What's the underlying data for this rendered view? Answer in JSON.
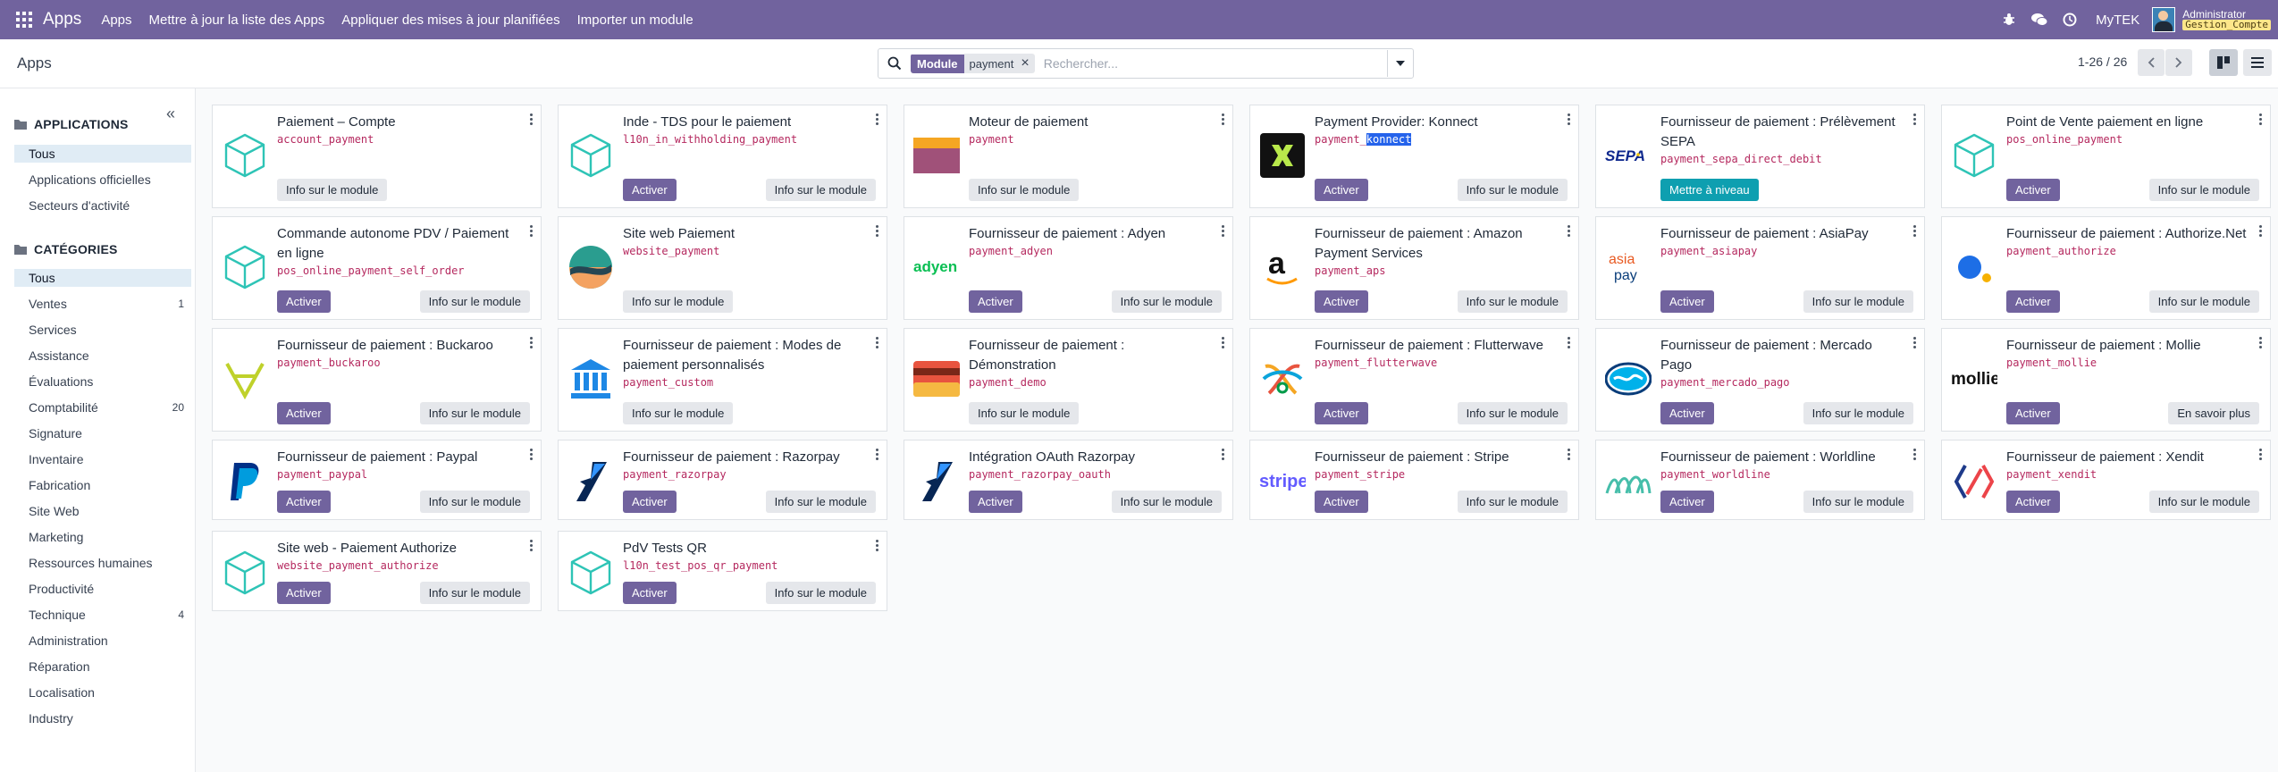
{
  "navbar": {
    "brand": "Apps",
    "menu": [
      "Apps",
      "Mettre à jour la liste des Apps",
      "Appliquer des mises à jour planifiées",
      "Importer un module"
    ],
    "company": "MyTEK",
    "user_name": "Administrator",
    "user_db": "Gestion_Compte",
    "icons": [
      "bug-icon",
      "chat-icon",
      "clock-icon"
    ]
  },
  "control": {
    "breadcrumb": "Apps",
    "search": {
      "facet_label": "Module",
      "facet_value": "payment",
      "placeholder": "Rechercher..."
    },
    "pager": "1-26 / 26"
  },
  "sidebar": {
    "applications_header": "APPLICATIONS",
    "applications": [
      {
        "label": "Tous",
        "active": true
      },
      {
        "label": "Applications officielles"
      },
      {
        "label": "Secteurs d'activité"
      }
    ],
    "categories_header": "CATÉGORIES",
    "categories": [
      {
        "label": "Tous",
        "active": true,
        "count": ""
      },
      {
        "label": "Ventes",
        "count": "1"
      },
      {
        "label": "Services",
        "count": ""
      },
      {
        "label": "Assistance",
        "count": ""
      },
      {
        "label": "Évaluations",
        "count": ""
      },
      {
        "label": "Comptabilité",
        "count": "20"
      },
      {
        "label": "Signature",
        "count": ""
      },
      {
        "label": "Inventaire",
        "count": ""
      },
      {
        "label": "Fabrication",
        "count": ""
      },
      {
        "label": "Site Web",
        "count": ""
      },
      {
        "label": "Marketing",
        "count": ""
      },
      {
        "label": "Ressources humaines",
        "count": ""
      },
      {
        "label": "Productivité",
        "count": ""
      },
      {
        "label": "Technique",
        "count": "4"
      },
      {
        "label": "Administration",
        "count": ""
      },
      {
        "label": "Réparation",
        "count": ""
      },
      {
        "label": "Localisation",
        "count": ""
      },
      {
        "label": "Industry",
        "count": ""
      }
    ]
  },
  "labels": {
    "activate": "Activer",
    "info": "Info sur le module",
    "upgrade": "Mettre à niveau",
    "learn_more": "En savoir plus"
  },
  "modules": [
    {
      "title": "Paiement – Compte",
      "tech": "account_payment",
      "icon": "cube-icon",
      "primary": "",
      "secondary": "info"
    },
    {
      "title": "Inde - TDS pour le paiement",
      "tech": "l10n_in_withholding_payment",
      "icon": "cube-icon",
      "primary": "activate",
      "secondary": "info"
    },
    {
      "title": "Moteur de paiement",
      "tech": "payment",
      "icon": "payment-card-icon",
      "primary": "",
      "secondary": "info"
    },
    {
      "title": "Payment Provider: Konnect",
      "tech": "payment_konnect",
      "icon": "konnect-logo-icon",
      "primary": "activate",
      "secondary": "info"
    },
    {
      "title": "Fournisseur de paiement : Prélèvement SEPA",
      "tech": "payment_sepa_direct_debit",
      "icon": "sepa-logo-icon",
      "primary": "upgrade",
      "secondary": ""
    },
    {
      "title": "Point de Vente paiement en ligne",
      "tech": "pos_online_payment",
      "icon": "cube-icon",
      "primary": "activate",
      "secondary": "info"
    },
    {
      "title": "Commande autonome PDV / Paiement en ligne",
      "tech": "pos_online_payment_self_order",
      "icon": "cube-icon",
      "primary": "activate",
      "secondary": "info"
    },
    {
      "title": "Site web Paiement",
      "tech": "website_payment",
      "icon": "website-payment-icon",
      "primary": "",
      "secondary": "info"
    },
    {
      "title": "Fournisseur de paiement : Adyen",
      "tech": "payment_adyen",
      "icon": "adyen-logo-icon",
      "primary": "activate",
      "secondary": "info"
    },
    {
      "title": "Fournisseur de paiement : Amazon Payment Services",
      "tech": "payment_aps",
      "icon": "amazon-logo-icon",
      "primary": "activate",
      "secondary": "info"
    },
    {
      "title": "Fournisseur de paiement : AsiaPay",
      "tech": "payment_asiapay",
      "icon": "asiapay-logo-icon",
      "primary": "activate",
      "secondary": "info"
    },
    {
      "title": "Fournisseur de paiement : Authorize.Net",
      "tech": "payment_authorize",
      "icon": "authorize-logo-icon",
      "primary": "activate",
      "secondary": "info"
    },
    {
      "title": "Fournisseur de paiement : Buckaroo",
      "tech": "payment_buckaroo",
      "icon": "buckaroo-logo-icon",
      "primary": "activate",
      "secondary": "info"
    },
    {
      "title": "Fournisseur de paiement : Modes de paiement personnalisés",
      "tech": "payment_custom",
      "icon": "bank-icon",
      "primary": "",
      "secondary": "info"
    },
    {
      "title": "Fournisseur de paiement : Démonstration",
      "tech": "payment_demo",
      "icon": "demo-card-icon",
      "primary": "",
      "secondary": "info"
    },
    {
      "title": "Fournisseur de paiement : Flutterwave",
      "tech": "payment_flutterwave",
      "icon": "flutterwave-logo-icon",
      "primary": "activate",
      "secondary": "info"
    },
    {
      "title": "Fournisseur de paiement : Mercado Pago",
      "tech": "payment_mercado_pago",
      "icon": "mercadopago-logo-icon",
      "primary": "activate",
      "secondary": "info"
    },
    {
      "title": "Fournisseur de paiement : Mollie",
      "tech": "payment_mollie",
      "icon": "mollie-logo-icon",
      "primary": "activate",
      "secondary": "learn_more"
    },
    {
      "title": "Fournisseur de paiement : Paypal",
      "tech": "payment_paypal",
      "icon": "paypal-logo-icon",
      "primary": "activate",
      "secondary": "info"
    },
    {
      "title": "Fournisseur de paiement : Razorpay",
      "tech": "payment_razorpay",
      "icon": "razorpay-logo-icon",
      "primary": "activate",
      "secondary": "info"
    },
    {
      "title": "Intégration OAuth Razorpay",
      "tech": "payment_razorpay_oauth",
      "icon": "razorpay-logo-icon",
      "primary": "activate",
      "secondary": "info"
    },
    {
      "title": "Fournisseur de paiement : Stripe",
      "tech": "payment_stripe",
      "icon": "stripe-logo-icon",
      "primary": "activate",
      "secondary": "info"
    },
    {
      "title": "Fournisseur de paiement : Worldline",
      "tech": "payment_worldline",
      "icon": "worldline-logo-icon",
      "primary": "activate",
      "secondary": "info"
    },
    {
      "title": "Fournisseur de paiement : Xendit",
      "tech": "payment_xendit",
      "icon": "xendit-logo-icon",
      "primary": "activate",
      "secondary": "info"
    },
    {
      "title": "Site web - Paiement Authorize",
      "tech": "website_payment_authorize",
      "icon": "cube-icon",
      "primary": "activate",
      "secondary": "info"
    },
    {
      "title": "PdV Tests QR",
      "tech": "l10n_test_pos_qr_payment",
      "icon": "cube-icon",
      "primary": "activate",
      "secondary": "info"
    }
  ],
  "colors": {
    "navbar": "#71639e",
    "primary_button": "#71639e",
    "upgrade_button": "#0e9fb0",
    "tech_name": "#b5295f",
    "cube_icon": "#2ec4b6"
  }
}
